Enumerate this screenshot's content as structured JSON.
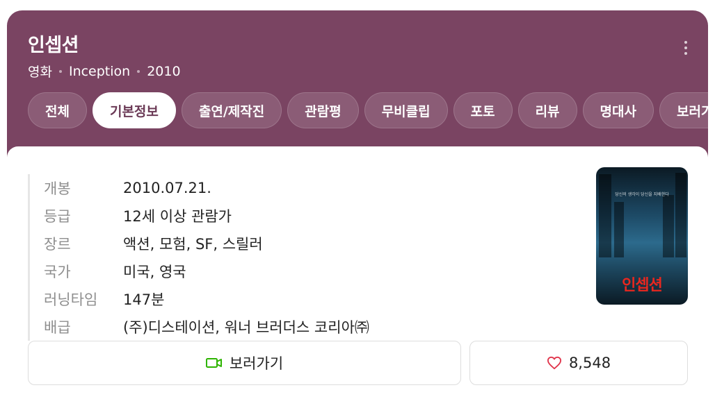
{
  "header": {
    "title": "인셉션",
    "category": "영화",
    "original_title": "Inception",
    "year": "2010"
  },
  "tabs": [
    {
      "label": "전체",
      "active": false
    },
    {
      "label": "기본정보",
      "active": true
    },
    {
      "label": "출연/제작진",
      "active": false
    },
    {
      "label": "관람평",
      "active": false
    },
    {
      "label": "무비클립",
      "active": false
    },
    {
      "label": "포토",
      "active": false
    },
    {
      "label": "리뷰",
      "active": false
    },
    {
      "label": "명대사",
      "active": false
    },
    {
      "label": "보러가기",
      "active": false
    }
  ],
  "info": [
    {
      "label": "개봉",
      "value": "2010.07.21."
    },
    {
      "label": "등급",
      "value": "12세 이상 관람가"
    },
    {
      "label": "장르",
      "value": "액션, 모험, SF, 스릴러"
    },
    {
      "label": "국가",
      "value": "미국, 영국"
    },
    {
      "label": "러닝타임",
      "value": "147분"
    },
    {
      "label": "배급",
      "value": "(주)디스테이션, 워너 브러더스 코리아㈜"
    }
  ],
  "poster": {
    "title_text": "인셉션",
    "tagline": "당신의 생각이 당신을 지배한다"
  },
  "actions": {
    "watch_label": "보러가기",
    "like_count": "8,548"
  },
  "colors": {
    "header_bg": "#7a4462",
    "watch_icon": "#2db400",
    "heart_icon": "#e0334a"
  },
  "icons": {
    "more": "more-vertical-icon",
    "watch": "video-camera-icon",
    "like": "heart-icon"
  }
}
